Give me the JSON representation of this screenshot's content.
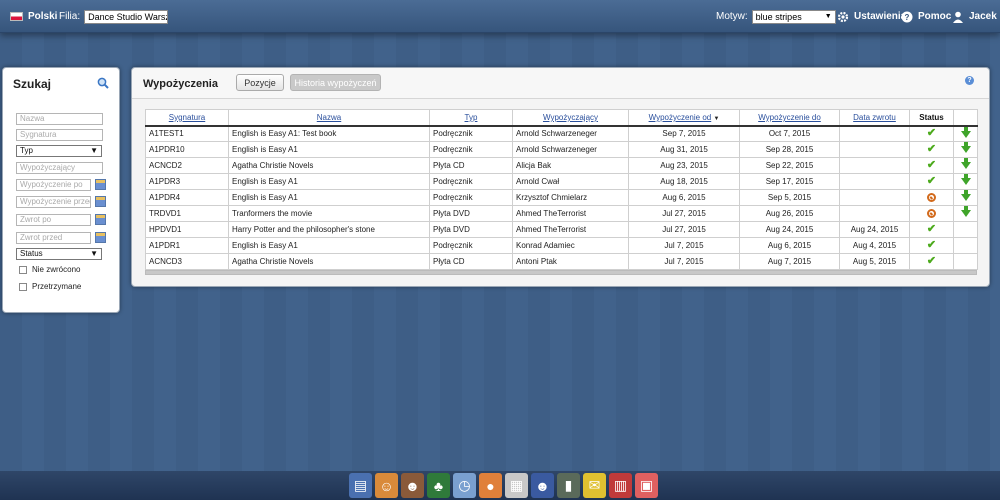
{
  "topbar": {
    "language": "Polski",
    "branch_label": "Filia:",
    "branch_value": "Dance Studio Warsza",
    "theme_label": "Motyw:",
    "theme_value": "blue stripes",
    "settings": "Ustawienia",
    "help": "Pomoc",
    "user": "Jacek"
  },
  "search": {
    "title": "Szukaj",
    "fields": {
      "nazwa": "Nazwa",
      "sygnatura": "Sygnatura",
      "typ": "Typ",
      "wypozyczajacy": "Wypożyczający",
      "wyp_po": "Wypożyczenie po",
      "wyp_przed": "Wypożyczenie przed",
      "zwrot_po": "Zwrot po",
      "zwrot_przed": "Zwrot przed",
      "status": "Status",
      "nie_zwrocono": "Nie zwrócono",
      "przetrzymane": "Przetrzymane"
    }
  },
  "main": {
    "title": "Wypożyczenia",
    "tab_pozycje": "Pozycje",
    "tab_historia": "Historia wypożyczeń",
    "columns": [
      "Sygnatura",
      "Nazwa",
      "Typ",
      "Wypożyczający",
      "Wypożyczenie od",
      "Wypożyczenie do",
      "Data zwrotu",
      "Status"
    ],
    "rows": [
      {
        "syg": "A1TEST1",
        "nazwa": "English is Easy A1: Test book",
        "typ": "Podręcznik",
        "osoba": "Arnold Schwarzeneger",
        "od": "Sep 7, 2015",
        "do": "Oct 7, 2015",
        "zwrot": "",
        "status": "ok",
        "return": true
      },
      {
        "syg": "A1PDR10",
        "nazwa": "English is Easy A1",
        "typ": "Podręcznik",
        "osoba": "Arnold Schwarzeneger",
        "od": "Aug 31, 2015",
        "do": "Sep 28, 2015",
        "zwrot": "",
        "status": "ok",
        "return": true
      },
      {
        "syg": "ACNCD2",
        "nazwa": "Agatha Christie Novels",
        "typ": "Płyta CD",
        "osoba": "Alicja Bak",
        "od": "Aug 23, 2015",
        "do": "Sep 22, 2015",
        "zwrot": "",
        "status": "ok",
        "return": true
      },
      {
        "syg": "A1PDR3",
        "nazwa": "English is Easy A1",
        "typ": "Podręcznik",
        "osoba": "Arnold Cwał",
        "od": "Aug 18, 2015",
        "do": "Sep 17, 2015",
        "zwrot": "",
        "status": "ok",
        "return": true
      },
      {
        "syg": "A1PDR4",
        "nazwa": "English is Easy A1",
        "typ": "Podręcznik",
        "osoba": "Krzysztof Chmielarz",
        "od": "Aug 6, 2015",
        "do": "Sep 5, 2015",
        "zwrot": "",
        "status": "overdue",
        "return": true
      },
      {
        "syg": "TRDVD1",
        "nazwa": "Tranformers the movie",
        "typ": "Płyta DVD",
        "osoba": "Ahmed TheTerrorist",
        "od": "Jul 27, 2015",
        "do": "Aug 26, 2015",
        "zwrot": "",
        "status": "overdue",
        "return": true
      },
      {
        "syg": "HPDVD1",
        "nazwa": "Harry Potter and the philosopher's stone",
        "typ": "Płyta DVD",
        "osoba": "Ahmed TheTerrorist",
        "od": "Jul 27, 2015",
        "do": "Aug 24, 2015",
        "zwrot": "Aug 24, 2015",
        "status": "ok",
        "return": false
      },
      {
        "syg": "A1PDR1",
        "nazwa": "English is Easy A1",
        "typ": "Podręcznik",
        "osoba": "Konrad Adamiec",
        "od": "Jul 7, 2015",
        "do": "Aug 6, 2015",
        "zwrot": "Aug 4, 2015",
        "status": "ok",
        "return": false
      },
      {
        "syg": "ACNCD3",
        "nazwa": "Agatha Christie Novels",
        "typ": "Płyta CD",
        "osoba": "Antoni Ptak",
        "od": "Jul 7, 2015",
        "do": "Aug 7, 2015",
        "zwrot": "Aug 5, 2015",
        "status": "ok",
        "return": false
      }
    ]
  },
  "dock": {
    "icons": [
      "id-card-icon",
      "librarian-icon",
      "teacher-icon",
      "blackboard-icon",
      "clock-icon",
      "piggy-bank-icon",
      "calculator-icon",
      "users-icon",
      "phone-icon",
      "mail-icon",
      "books-icon",
      "calendar-icon"
    ]
  },
  "colors": {
    "accent_link": "#2a4f9c",
    "status_ok": "#4caa1c",
    "status_overdue": "#d26a1c",
    "return_arrow": "#3fa42a"
  }
}
